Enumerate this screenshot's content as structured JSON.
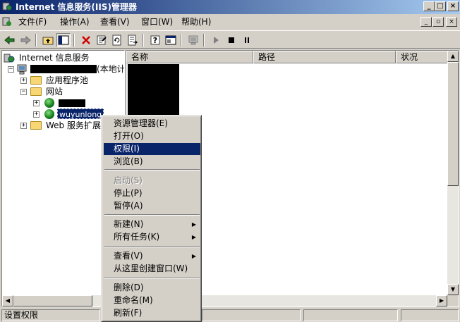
{
  "window": {
    "title": "Internet 信息服务(IIS)管理器",
    "minimize_glyph": "_",
    "maximize_glyph": "□",
    "close_glyph": "×"
  },
  "menu": [
    {
      "label": "文件(F)"
    },
    {
      "label": "操作(A)"
    },
    {
      "label": "查看(V)"
    },
    {
      "label": "窗口(W)"
    },
    {
      "label": "帮助(H)"
    }
  ],
  "toolbar": {
    "icons": [
      "back-icon",
      "forward-icon",
      "up-level-icon",
      "show-hide-tree-icon",
      "delete-icon",
      "properties-icon",
      "refresh-icon",
      "export-list-icon",
      "help-icon",
      "console-icon",
      "computer-icon",
      "play-icon",
      "stop-icon",
      "pause-icon"
    ]
  },
  "tree": {
    "root": "Internet 信息服务",
    "server_suffix": "(本地计",
    "app_pools": "应用程序池",
    "websites": "网站",
    "site2": "wuyunlong",
    "web_ext": "Web 服务扩展"
  },
  "list": {
    "columns": [
      "名称",
      "路径",
      "状况"
    ]
  },
  "context_menu": {
    "items": [
      {
        "label": "资源管理器(E)",
        "state": "normal"
      },
      {
        "label": "打开(O)",
        "state": "normal"
      },
      {
        "label": "权限(I)",
        "state": "selected"
      },
      {
        "label": "浏览(B)",
        "state": "normal"
      },
      {
        "label": "启动(S)",
        "state": "disabled"
      },
      {
        "label": "停止(P)",
        "state": "normal"
      },
      {
        "label": "暂停(A)",
        "state": "normal"
      },
      {
        "label": "新建(N)",
        "state": "submenu"
      },
      {
        "label": "所有任务(K)",
        "state": "submenu"
      },
      {
        "label": "查看(V)",
        "state": "submenu"
      },
      {
        "label": "从这里创建窗口(W)",
        "state": "normal"
      },
      {
        "label": "删除(D)",
        "state": "normal"
      },
      {
        "label": "重命名(M)",
        "state": "normal"
      },
      {
        "label": "刷新(F)",
        "state": "normal"
      }
    ]
  },
  "status": {
    "text": "设置权限"
  },
  "colors": {
    "title_start": "#0a246a",
    "title_end": "#a6caf0",
    "highlight": "#0a246a",
    "face": "#d4d0c8"
  }
}
